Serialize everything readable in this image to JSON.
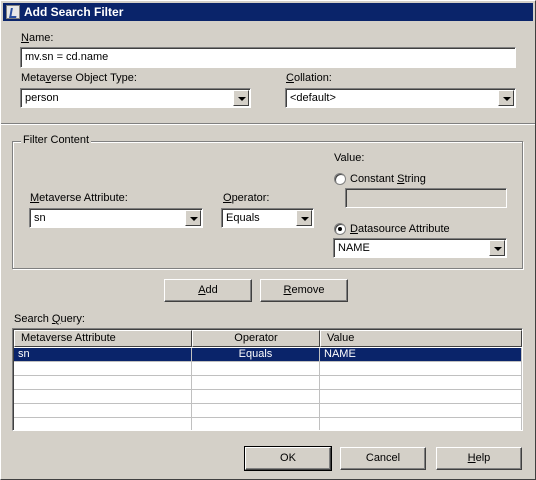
{
  "window": {
    "title": "Add Search Filter",
    "icon": "app-icon"
  },
  "name_field": {
    "label_pre": "",
    "label_accel": "N",
    "label_post": "ame:",
    "value": "mv.sn = cd.name"
  },
  "object_type": {
    "label_pre": "Meta",
    "label_accel": "v",
    "label_post": "erse Object Type:",
    "value": "person"
  },
  "collation": {
    "label_pre": "",
    "label_accel": "C",
    "label_post": "ollation:",
    "value": "<default>"
  },
  "filter_content": {
    "legend": "Filter Content",
    "mv_attribute": {
      "label_pre": "",
      "label_accel": "M",
      "label_post": "etaverse Attribute:",
      "value": "sn"
    },
    "operator": {
      "label_pre": "",
      "label_accel": "O",
      "label_post": "perator:",
      "value": "Equals"
    },
    "value_label": "Value:",
    "constant_string": {
      "label_pre": "Constant ",
      "label_accel": "S",
      "label_post": "tring",
      "checked": false,
      "value": ""
    },
    "datasource_attribute": {
      "label_pre": "",
      "label_accel": "D",
      "label_post": "atasource Attribute",
      "checked": true,
      "value": "NAME"
    }
  },
  "buttons": {
    "add": {
      "label_pre": "",
      "label_accel": "A",
      "label_post": "dd"
    },
    "remove": {
      "label_pre": "",
      "label_accel": "R",
      "label_post": "emove"
    },
    "ok": "OK",
    "cancel": "Cancel",
    "help": {
      "label_pre": "",
      "label_accel": "H",
      "label_post": "elp"
    }
  },
  "search_query": {
    "label_pre": "Search ",
    "label_accel": "Q",
    "label_post": "uery:",
    "columns": [
      "Metaverse Attribute",
      "Operator",
      "Value"
    ],
    "rows": [
      {
        "attribute": "sn",
        "operator": "Equals",
        "value": "NAME",
        "selected": true
      }
    ]
  }
}
